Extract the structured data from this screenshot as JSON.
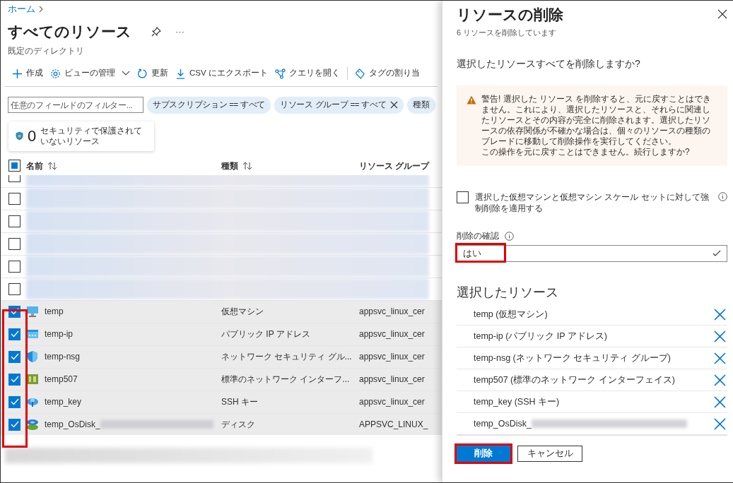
{
  "breadcrumb": [
    {
      "label": "ホーム"
    }
  ],
  "page": {
    "title": "すべてのリソース",
    "subtitle": "既定のディレクトリ",
    "more": "···"
  },
  "toolbar": [
    {
      "label": "作成",
      "dropdown": false
    },
    {
      "label": "ビューの管理",
      "dropdown": true
    },
    {
      "label": "更新",
      "dropdown": false
    },
    {
      "label": "CSV にエクスポート",
      "dropdown": false
    },
    {
      "label": "クエリを開く",
      "dropdown": false
    },
    {
      "label": "タグの割り当",
      "dropdown": false
    }
  ],
  "filter": {
    "placeholder": "任意のフィールドのフィルター..."
  },
  "filter_chips": [
    {
      "label": "サブスクリプション == すべて",
      "removable": false
    },
    {
      "label": "リソース グループ == すべて",
      "removable": true
    },
    {
      "label": "種類",
      "removable": false
    }
  ],
  "security_card": {
    "count": "0",
    "label": "セキュリティで保護されていないリソース"
  },
  "table": {
    "select_all": {
      "indeterminate": true
    },
    "columns": [
      {
        "label": "名前"
      },
      {
        "label": "種類"
      },
      {
        "label": "リソース グループ"
      }
    ],
    "rows": [
      {
        "kind": "blurred",
        "checked": false
      },
      {
        "kind": "blurred",
        "checked": false
      },
      {
        "kind": "blurred",
        "checked": false
      },
      {
        "kind": "blurred",
        "checked": false
      },
      {
        "kind": "blurred",
        "checked": false
      },
      {
        "kind": "blurred",
        "checked": false
      },
      {
        "kind": "vm",
        "checked": true,
        "name": "temp",
        "name_blurred": false,
        "type": "仮想マシン",
        "group": "appsvc_linux_cer"
      },
      {
        "kind": "ip",
        "checked": true,
        "name": "temp-ip",
        "name_blurred": false,
        "type": "パブリック IP アドレス",
        "group": "appsvc_linux_cer"
      },
      {
        "kind": "nsg",
        "checked": true,
        "name": "temp-nsg",
        "name_blurred": false,
        "type": "ネットワーク セキュリティ グル...",
        "group": "appsvc_linux_cer"
      },
      {
        "kind": "nic",
        "checked": true,
        "name": "temp507",
        "name_blurred": false,
        "type": "標準のネットワーク インターフ...",
        "group": "appsvc_linux_cer"
      },
      {
        "kind": "key",
        "checked": true,
        "name": "temp_key",
        "name_blurred": false,
        "type": "SSH キー",
        "group": "appsvc_linux_cer"
      },
      {
        "kind": "disk",
        "checked": true,
        "name": "temp_OsDisk_",
        "name_blurred": true,
        "type": "ディスク",
        "group": "APPSVC_LINUX_"
      }
    ]
  },
  "panel": {
    "title": "リソースの削除",
    "subtitle": "6 リソースを削除しています",
    "question": "選択したリソースすべてを削除しますか?",
    "warning": [
      "警告! 選択した リソース を削除すると、元に戻すことはできません。これにより、選択したリソースと、それらに関連したリソースとその内容が完全に削除されます。選択したリソースの依存関係が不確かな場合は、個々のリソースの種類のブレードに移動して削除操作を実行してください。",
      "この操作を元に戻すことはできません。続行しますか?"
    ],
    "force_delete": {
      "label": "選択した仮想マシンと仮想マシン スケール セットに対して強制削除を適用する",
      "checked": false
    },
    "confirm": {
      "label": "削除の確認",
      "value": "はい",
      "valid": true
    },
    "selected_heading": "選択したリソース",
    "selected": [
      {
        "label": "temp (仮想マシン)",
        "blurred": false
      },
      {
        "label": "temp-ip (パブリック IP アドレス)",
        "blurred": false
      },
      {
        "label": "temp-nsg (ネットワーク セキュリティ グループ)",
        "blurred": false
      },
      {
        "label": "temp507 (標準のネットワーク インターフェイス)",
        "blurred": false
      },
      {
        "label": "temp_key (SSH キー)",
        "blurred": false
      },
      {
        "label": "temp_OsDisk_",
        "blurred": true
      }
    ],
    "buttons": [
      {
        "label": "削除",
        "kind": "primary"
      },
      {
        "label": "キャンセル",
        "kind": "secondary"
      }
    ]
  }
}
